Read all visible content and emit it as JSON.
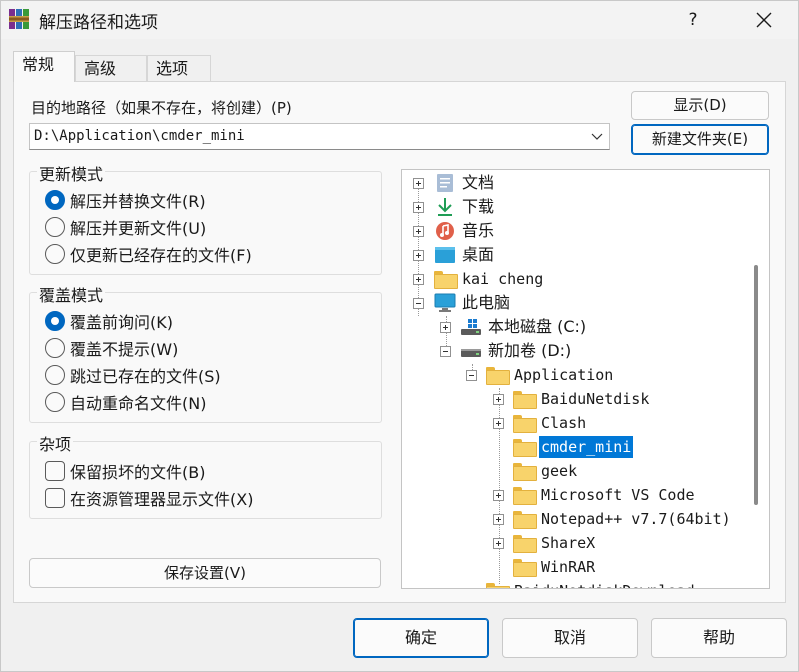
{
  "window": {
    "title": "解压路径和选项",
    "help_label": "?"
  },
  "tabs": [
    {
      "label": "常规",
      "active": true
    },
    {
      "label": "高级",
      "active": false
    },
    {
      "label": "选项",
      "active": false
    }
  ],
  "destination": {
    "label": "目的地路径（如果不存在，将创建）(P)",
    "value": "D:\\Application\\cmder_mini",
    "show_button": "显示(D)",
    "new_folder_button": "新建文件夹(E)"
  },
  "update_mode": {
    "title": "更新模式",
    "options": [
      {
        "label": "解压并替换文件(R)",
        "selected": true
      },
      {
        "label": "解压并更新文件(U)",
        "selected": false
      },
      {
        "label": "仅更新已经存在的文件(F)",
        "selected": false
      }
    ]
  },
  "overwrite_mode": {
    "title": "覆盖模式",
    "options": [
      {
        "label": "覆盖前询问(K)",
        "selected": true
      },
      {
        "label": "覆盖不提示(W)",
        "selected": false
      },
      {
        "label": "跳过已存在的文件(S)",
        "selected": false
      },
      {
        "label": "自动重命名文件(N)",
        "selected": false
      }
    ]
  },
  "misc": {
    "title": "杂项",
    "options": [
      {
        "label": "保留损坏的文件(B)",
        "checked": false
      },
      {
        "label": "在资源管理器显示文件(X)",
        "checked": false
      }
    ]
  },
  "save_settings_button": "保存设置(V)",
  "tree": {
    "items": [
      {
        "label": "文档",
        "icon": "documents-icon",
        "expander": "plus"
      },
      {
        "label": "下载",
        "icon": "downloads-icon",
        "expander": "plus"
      },
      {
        "label": "音乐",
        "icon": "music-icon",
        "expander": "plus"
      },
      {
        "label": "桌面",
        "icon": "desktop-icon",
        "expander": "plus"
      },
      {
        "label": "kai cheng",
        "icon": "folder-icon",
        "expander": "plus"
      },
      {
        "label": "此电脑",
        "icon": "this-pc-icon",
        "expander": "minus"
      },
      {
        "label": "本地磁盘 (C:)",
        "icon": "system-drive-icon",
        "expander": "plus"
      },
      {
        "label": "新加卷 (D:)",
        "icon": "drive-icon",
        "expander": "minus"
      },
      {
        "label": "Application",
        "icon": "folder-icon",
        "expander": "minus"
      },
      {
        "label": "BaiduNetdisk",
        "icon": "folder-icon",
        "expander": "plus"
      },
      {
        "label": "Clash",
        "icon": "folder-icon",
        "expander": "plus"
      },
      {
        "label": "cmder_mini",
        "icon": "folder-icon",
        "expander": "none",
        "selected": true
      },
      {
        "label": "geek",
        "icon": "folder-icon",
        "expander": "none"
      },
      {
        "label": "Microsoft VS Code",
        "icon": "folder-icon",
        "expander": "plus"
      },
      {
        "label": "Notepad++ v7.7(64bit)",
        "icon": "folder-icon",
        "expander": "plus"
      },
      {
        "label": "ShareX",
        "icon": "folder-icon",
        "expander": "plus"
      },
      {
        "label": "WinRAR",
        "icon": "folder-icon",
        "expander": "none"
      },
      {
        "label": "BaiduNetdiskDownload",
        "icon": "folder-icon",
        "expander": "plus"
      }
    ]
  },
  "footer": {
    "ok": "确定",
    "cancel": "取消",
    "help": "帮助"
  },
  "colors": {
    "accent": "#0067c0",
    "selection": "#0078d7"
  }
}
